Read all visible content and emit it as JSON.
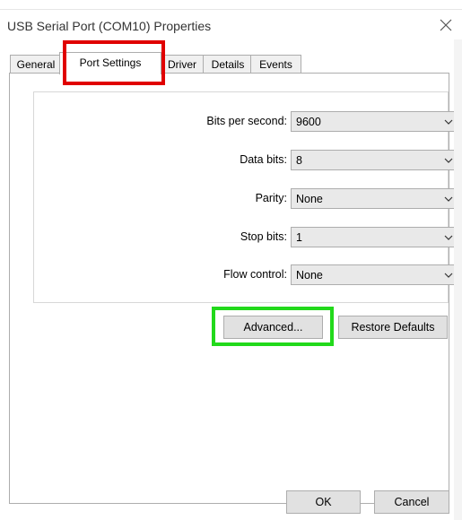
{
  "window": {
    "top_fragment": "",
    "title": "USB Serial Port (COM10) Properties",
    "close_icon": "close-icon"
  },
  "tabs": [
    {
      "label": "General",
      "active": false
    },
    {
      "label": "Port Settings",
      "active": true
    },
    {
      "label": "Driver",
      "active": false
    },
    {
      "label": "Details",
      "active": false
    },
    {
      "label": "Events",
      "active": false
    }
  ],
  "port_settings": {
    "bits_per_second": {
      "label": "Bits per second:",
      "value": "9600"
    },
    "data_bits": {
      "label": "Data bits:",
      "value": "8"
    },
    "parity": {
      "label": "Parity:",
      "value": "None"
    },
    "stop_bits": {
      "label": "Stop bits:",
      "value": "1"
    },
    "flow_control": {
      "label": "Flow control:",
      "value": "None"
    }
  },
  "buttons": {
    "advanced": "Advanced...",
    "restore_defaults": "Restore Defaults",
    "ok": "OK",
    "cancel": "Cancel"
  },
  "highlights": {
    "tab_highlight_color": "#e00000",
    "button_highlight_color": "#22d91b"
  },
  "colors": {
    "button_bg": "#e1e1e1",
    "select_bg": "#e9e9e9",
    "border": "#adadad"
  }
}
